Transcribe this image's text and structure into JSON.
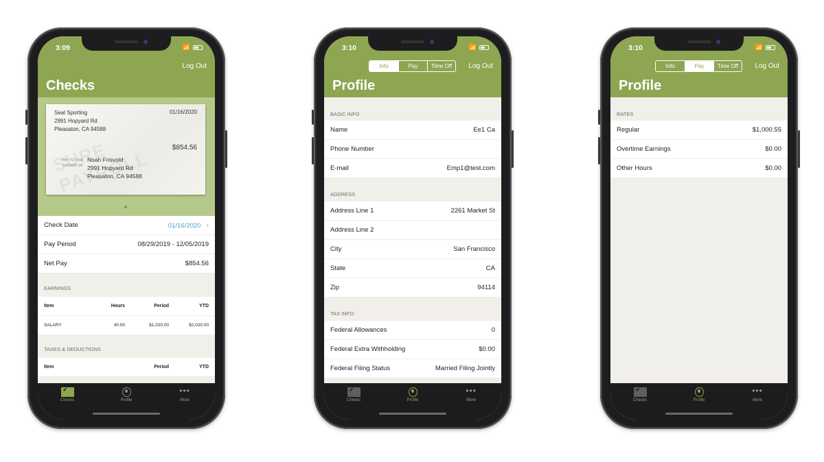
{
  "colors": {
    "brand_green": "#8ea651",
    "check_area_green": "#b5c98b",
    "link_blue": "#4f9bc9",
    "tabbar_dark": "#1c1c1c"
  },
  "tabbar": {
    "checks": "Checks",
    "profile": "Profile",
    "more": "More"
  },
  "phone1": {
    "time": "3:09",
    "logout": "Log Out",
    "title": "Checks",
    "check": {
      "payer_name": "Seal Sporting",
      "payer_address1": "2991 Hopyard Rd",
      "payer_address2": "Pleasaton, CA 94588",
      "date": "01/16/2020",
      "amount": "$854.56",
      "pay_to_label1": "PAY TO THE",
      "pay_to_label2": "ORDER OF",
      "payee_name": "Noah Frisvold",
      "payee_address1": "2991 Hopyard Rd",
      "payee_address2": "Pleasaton, CA 94588",
      "watermark": "SURE PAYROLL"
    },
    "summary": [
      {
        "label": "Check Date",
        "value": "01/16/2020"
      },
      {
        "label": "Pay Period",
        "value": "08/29/2019 - 12/05/2019"
      },
      {
        "label": "Net Pay",
        "value": "$854.56"
      }
    ],
    "earnings_header": "EARNINGS",
    "earnings_columns": [
      "Item",
      "Hours",
      "Period",
      "YTD"
    ],
    "earnings_rows": [
      {
        "item": "SALARY",
        "hours": "40.00",
        "period": "$1,020.00",
        "ytd": "$2,020.00"
      }
    ],
    "taxes_header": "TAXES & DEDUCTIONS",
    "taxes_columns": [
      "Item",
      "Period",
      "YTD"
    ]
  },
  "phone2": {
    "time": "3:10",
    "logout": "Log Out",
    "title": "Profile",
    "segments": [
      "Info",
      "Pay",
      "Time Off"
    ],
    "basic_header": "BASIC INFO",
    "basic": [
      {
        "label": "Name",
        "value": "Ee1 Ca"
      },
      {
        "label": "Phone Number",
        "value": ""
      },
      {
        "label": "E-mail",
        "value": "Emp1@test.com"
      }
    ],
    "address_header": "ADDRESS",
    "address": [
      {
        "label": "Address Line 1",
        "value": "2261 Market St"
      },
      {
        "label": "Address Line 2",
        "value": ""
      },
      {
        "label": "City",
        "value": "San Francisco"
      },
      {
        "label": "State",
        "value": "CA"
      },
      {
        "label": "Zip",
        "value": "94114"
      }
    ],
    "tax_header": "TAX INFO",
    "tax": [
      {
        "label": "Federal Allowances",
        "value": "0"
      },
      {
        "label": "Federal Extra Withholding",
        "value": "$0.00"
      },
      {
        "label": "Federal Filing Status",
        "value": "Married Filing Jointly"
      }
    ]
  },
  "phone3": {
    "time": "3:10",
    "logout": "Log Out",
    "title": "Profile",
    "segments": [
      "Info",
      "Pay",
      "Time Off"
    ],
    "rates_header": "RATES",
    "rates": [
      {
        "label": "Regular",
        "value": "$1,000.55"
      },
      {
        "label": "Overtime Earnings",
        "value": "$0.00"
      },
      {
        "label": "Other Hours",
        "value": "$0.00"
      }
    ]
  }
}
